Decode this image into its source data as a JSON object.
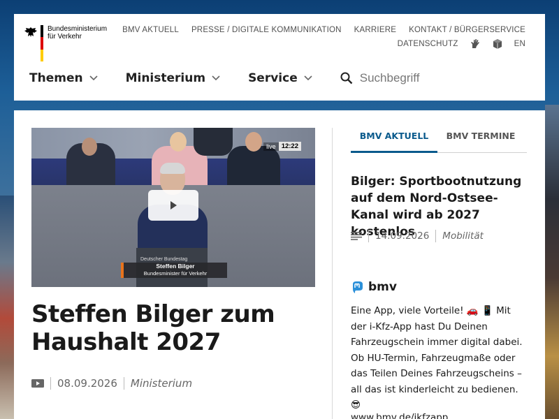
{
  "logo": {
    "line1": "Bundesministerium",
    "line2": "für Verkehr"
  },
  "topnav": {
    "row1": [
      "BMV AKTUELL",
      "PRESSE / DIGITALE KOMMUNIKATION",
      "KARRIERE",
      "KONTAKT / BÜRGERSERVICE"
    ],
    "row2": [
      "DATENSCHUTZ"
    ],
    "lang": "EN",
    "icons": [
      "sign-language-icon",
      "easy-language-icon"
    ]
  },
  "mainnav": {
    "items": [
      "Themen",
      "Ministerium",
      "Service"
    ],
    "search_placeholder": "Suchbegriff"
  },
  "video": {
    "live_label": "live",
    "duration": "12:22",
    "lectern_label": "Deutscher Bundestag",
    "speaker_name": "Steffen Bilger",
    "speaker_role": "Bundesminister für Verkehr"
  },
  "featured": {
    "title": "Steffen Bilger zum Haushalt 2027",
    "date": "08.09.2026",
    "category": "Ministerium",
    "media_icon": "video-icon"
  },
  "tabs": [
    "BMV AKTUELL",
    "BMV TERMINE"
  ],
  "news": {
    "title": "Bilger: Sportbootnutzung auf dem Nord-Ostsee-Kanal wird ab 2027 kostenlos",
    "date": "14.09.2026",
    "category": "Mobilität",
    "media_icon": "text-icon"
  },
  "social": {
    "account": "bmv",
    "icon": "mastodon-icon",
    "post": "Eine App, viele Vorteile! 🚗 📱 Mit der i-Kfz-App hast Du Deinen Fahrzeugschein immer digital dabei. Ob HU-Termin, Fahrzeugmaße oder das Teilen Deines Fahrzeugscheins – all das ist kinderleicht zu bedienen. 😎",
    "link": "www.bmv.de/ikfzapp"
  }
}
